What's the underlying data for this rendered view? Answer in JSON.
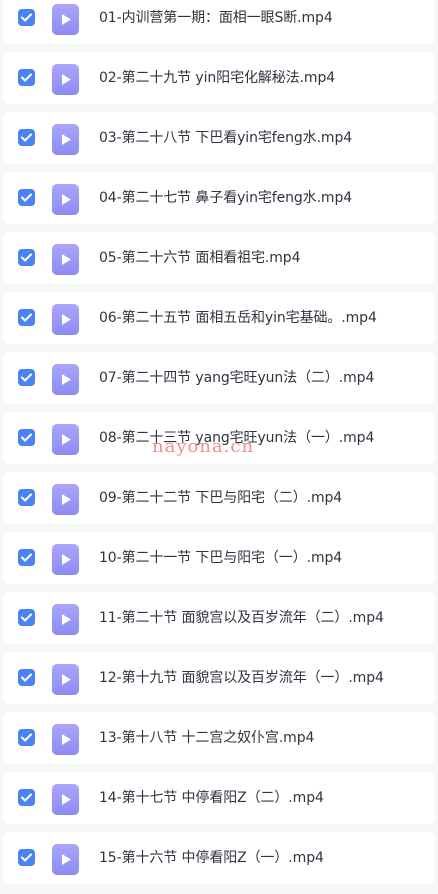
{
  "accent_color": "#4a82f7",
  "icon_color": "#9b98f8",
  "files": [
    {
      "name": "01-内训营第一期：面相一眼S断.mp4",
      "checked": true,
      "icon": "video-file-icon"
    },
    {
      "name": "02-第二十九节 yin阳宅化解秘法.mp4",
      "checked": true,
      "icon": "video-file-icon"
    },
    {
      "name": "03-第二十八节 下巴看yin宅feng水.mp4",
      "checked": true,
      "icon": "video-file-icon"
    },
    {
      "name": "04-第二十七节 鼻子看yin宅feng水.mp4",
      "checked": true,
      "icon": "video-file-icon"
    },
    {
      "name": "05-第二十六节 面相看祖宅.mp4",
      "checked": true,
      "icon": "video-file-icon"
    },
    {
      "name": "06-第二十五节 面相五岳和yin宅基础。.mp4",
      "checked": true,
      "icon": "video-file-icon"
    },
    {
      "name": "07-第二十四节 yang宅旺yun法（二）.mp4",
      "checked": true,
      "icon": "video-file-icon"
    },
    {
      "name": "08-第二十三节 yang宅旺yun法（一）.mp4",
      "checked": true,
      "icon": "video-file-icon"
    },
    {
      "name": "09-第二十二节 下巴与阳宅（二）.mp4",
      "checked": true,
      "icon": "video-file-icon"
    },
    {
      "name": "10-第二十一节 下巴与阳宅（一）.mp4",
      "checked": true,
      "icon": "video-file-icon"
    },
    {
      "name": "11-第二十节 面貌宫以及百岁流年（二）.mp4",
      "checked": true,
      "icon": "video-file-icon"
    },
    {
      "name": "12-第十九节 面貌宫以及百岁流年（一）.mp4",
      "checked": true,
      "icon": "video-file-icon"
    },
    {
      "name": "13-第十八节 十二宫之奴仆宫.mp4",
      "checked": true,
      "icon": "video-file-icon"
    },
    {
      "name": "14-第十七节 中停看阳Z（二）.mp4",
      "checked": true,
      "icon": "video-file-icon"
    },
    {
      "name": "15-第十六节 中停看阳Z（一）.mp4",
      "checked": true,
      "icon": "video-file-icon"
    }
  ],
  "watermark": "nayona.cn"
}
